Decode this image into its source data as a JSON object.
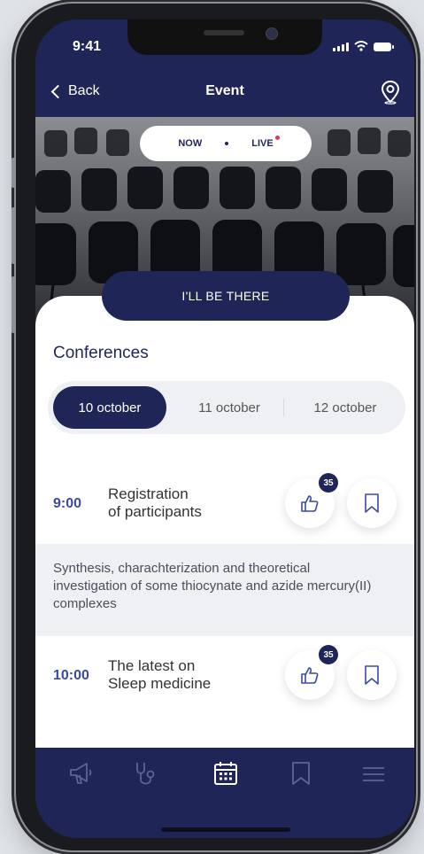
{
  "status_bar": {
    "time": "9:41"
  },
  "nav": {
    "back_label": "Back",
    "title": "Event"
  },
  "hero": {
    "now_label": "NOW",
    "live_label": "LIVE"
  },
  "cta": {
    "label": "I'LL BE THERE"
  },
  "section": {
    "title": "Conferences"
  },
  "date_tabs": [
    {
      "label": "10 october",
      "active": true
    },
    {
      "label": "11 october",
      "active": false
    },
    {
      "label": "12 october",
      "active": false
    }
  ],
  "events": [
    {
      "time": "9:00",
      "title_line1": "Registration",
      "title_line2": "of participants",
      "likes": "35"
    },
    {
      "time": "10:00",
      "title_line1": "The latest on",
      "title_line2": "Sleep medicine",
      "likes": "35"
    }
  ],
  "description": "Synthesis, charachterization and theoretical investigation of some thiocynate and azide mercury(II) complexes",
  "tabbar": {
    "icons": [
      "megaphone-icon",
      "stethoscope-icon",
      "calendar-icon",
      "bookmark-icon",
      "menu-icon"
    ],
    "active": "calendar-icon"
  },
  "colors": {
    "navy": "#1f2657",
    "accent_time": "#3b4aa3",
    "live_dot": "#e23a4a",
    "light_bg": "#eef0f4"
  }
}
